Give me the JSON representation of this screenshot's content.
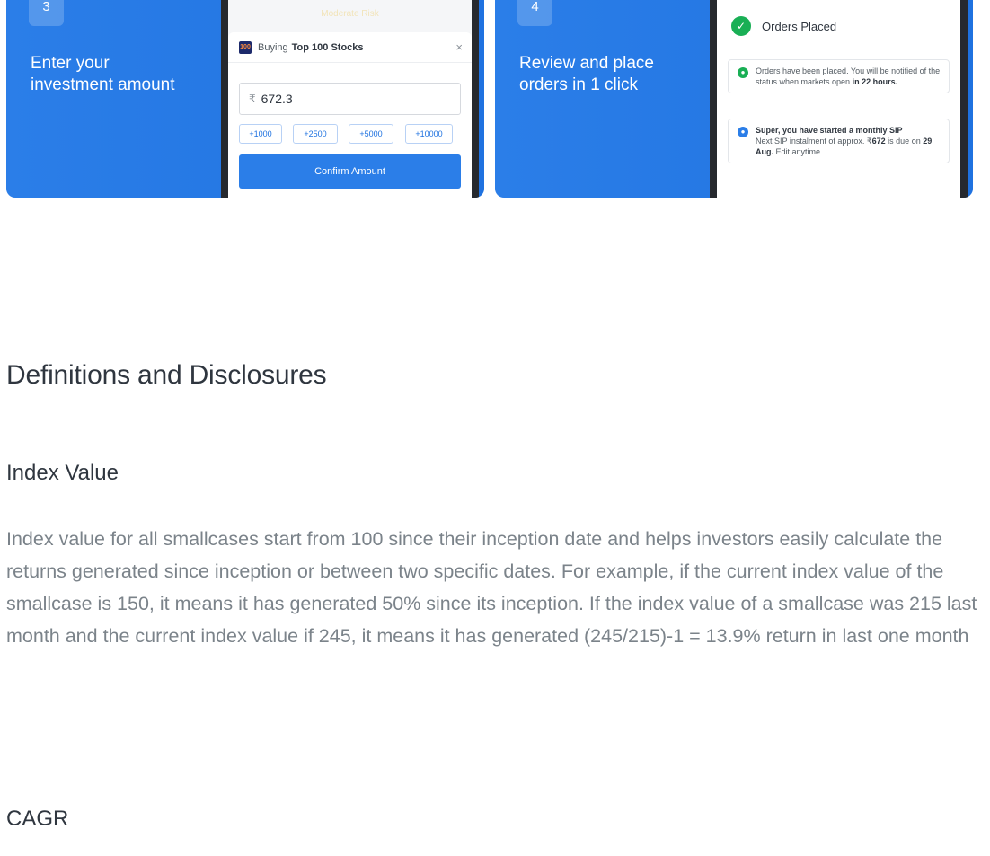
{
  "steps": [
    {
      "number": "3",
      "text": "Enter your investment amount"
    },
    {
      "number": "4",
      "text": "Review and place orders in 1 click"
    }
  ],
  "buy_screen": {
    "risk_label": "Moderate Risk",
    "logo_text": "100",
    "buying_prefix": "Buying",
    "buying_name": "Top 100 Stocks",
    "close_glyph": "×",
    "currency": "₹",
    "amount_value": "672.3",
    "quick_adds": [
      "+1000",
      "+2500",
      "+5000",
      "+10000"
    ],
    "confirm_label": "Confirm Amount"
  },
  "orders_screen": {
    "title": "Orders Placed",
    "note1_pre": "Orders have been placed. You will be notified of the status when markets open",
    "note1_bold": "in 22 hours.",
    "note2_title": "Super, you have started a monthly SIP",
    "note2_pre": "Next SIP instalment of approx. ₹",
    "note2_amount": "672",
    "note2_mid": "is due on",
    "note2_date": "29 Aug.",
    "note2_post": "Edit anytime"
  },
  "definitions": {
    "heading": "Definitions and Disclosures",
    "index_title": "Index Value",
    "index_body": "Index value for all smallcases start from 100 since their inception date and helps investors easily calculate the returns generated since inception or between two specific dates. For example, if the current index value of the smallcase is 150, it means it has generated 50% since its inception. If the index value of a smallcase was 215 last month and the current index value if 245, it means it has generated (245/215)-1 = 13.9% return in last one month",
    "cagr_title": "CAGR"
  },
  "colors": {
    "accent": "#1f72e0",
    "success": "#19af55",
    "text": "#2f363f",
    "muted": "#7b838a"
  }
}
